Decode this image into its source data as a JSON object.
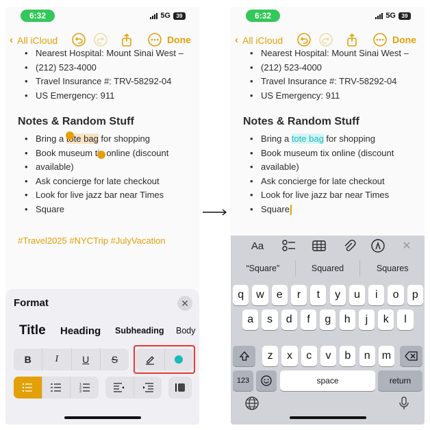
{
  "colors": {
    "accent": "#e3a008",
    "highlight_teal": "#1bbab9",
    "annotation_red": "#e53935",
    "status_green": "#34c759"
  },
  "status_bar": {
    "time": "6:32",
    "network": "5G",
    "battery": "39"
  },
  "nav": {
    "back_label": "All iCloud",
    "done_label": "Done",
    "icons": [
      "chevron-left-icon",
      "undo-icon",
      "redo-icon",
      "share-icon",
      "more-icon"
    ]
  },
  "note": {
    "top_items": [
      "Nearest Hospital: Mount Sinai West –",
      "(212) 523-4000",
      "Travel Insurance #: TRV-58292-04",
      "US Emergency: 911"
    ],
    "section_heading": "Notes & Random Stuff",
    "first_item": {
      "before": "Bring a ",
      "highlight": "tote bag",
      "after": " for shopping"
    },
    "items": [
      "Book museum tix online (discount",
      "available)",
      "Ask concierge for late checkout",
      "Look for live jazz bar near Times"
    ],
    "last_line": "Square",
    "hashtags": "#Travel2025 #NYCTrip #JulyVacation"
  },
  "format_panel": {
    "title": "Format",
    "close_symbol": "✕",
    "styles": [
      "Title",
      "Heading",
      "Subheading",
      "Body"
    ],
    "text_styles": [
      "B",
      "I",
      "U",
      "S"
    ],
    "highlight_tools": [
      "marker-pen-icon",
      "teal-color-dot-icon"
    ],
    "list_styles": [
      "bulleted-list-icon",
      "dashed-list-icon",
      "numbered-list-icon"
    ],
    "indent_tools": [
      "outdent-icon",
      "indent-icon"
    ],
    "block_quote": "block-quote-icon"
  },
  "arrow_icon": "right-arrow-icon",
  "keyboard": {
    "toolbar": {
      "format_label": "Aa",
      "icons": [
        "checklist-icon",
        "table-icon",
        "paperclip-icon",
        "markup-pen-icon",
        "close-icon"
      ],
      "close_symbol": "✕"
    },
    "suggestions": [
      "“Square”",
      "Squared",
      "Squares"
    ],
    "row1": [
      "q",
      "w",
      "e",
      "r",
      "t",
      "y",
      "u",
      "i",
      "o",
      "p"
    ],
    "row2": [
      "a",
      "s",
      "d",
      "f",
      "g",
      "h",
      "j",
      "k",
      "l"
    ],
    "row3": [
      "z",
      "x",
      "c",
      "v",
      "b",
      "n",
      "m"
    ],
    "shift_icon": "shift-icon",
    "delete_icon": "delete-icon",
    "numbers_label": "123",
    "emoji_icon": "emoji-icon",
    "space_label": "space",
    "return_label": "return",
    "globe_icon": "globe-icon",
    "mic_icon": "microphone-icon"
  }
}
